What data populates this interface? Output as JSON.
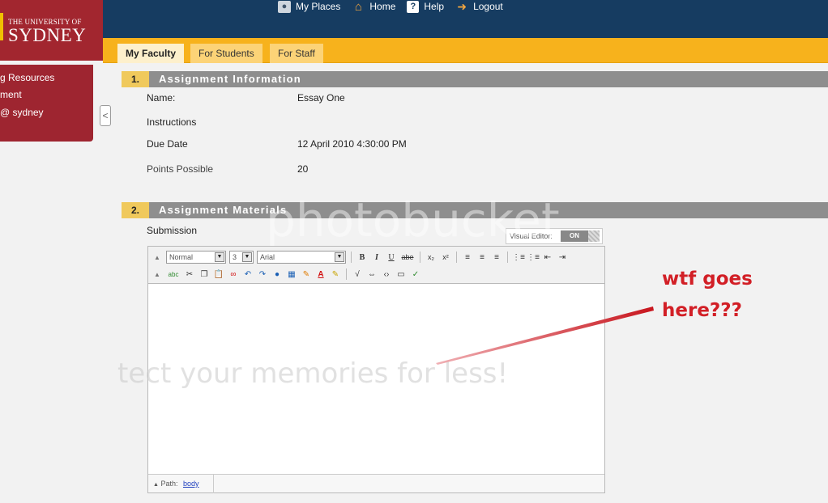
{
  "header": {
    "logo_line1": "THE UNIVERSITY OF",
    "logo_line2": "SYDNEY",
    "nav": [
      {
        "label": "My Places",
        "icon": "user-icon"
      },
      {
        "label": "Home",
        "icon": "home-icon"
      },
      {
        "label": "Help",
        "icon": "help-icon"
      },
      {
        "label": "Logout",
        "icon": "logout-icon"
      }
    ]
  },
  "tabs": [
    {
      "label": "My Faculty",
      "active": true
    },
    {
      "label": "For Students",
      "active": false
    },
    {
      "label": "For Staff",
      "active": false
    }
  ],
  "sidebar": {
    "items": [
      "g Resources",
      "ment",
      "@ sydney"
    ],
    "collapse_glyph": "<"
  },
  "section1": {
    "number": "1.",
    "title": "Assignment Information",
    "rows": {
      "name_label": "Name:",
      "name_value": "Essay One",
      "instructions_label": "Instructions",
      "due_label": "Due Date",
      "due_value": "12 April 2010 4:30:00 PM",
      "points_label": "Points Possible",
      "points_value": "20"
    }
  },
  "section2": {
    "number": "2.",
    "title": "Assignment Materials",
    "submission_label": "Submission"
  },
  "editor": {
    "visual_editor_label": "Visual Editor:",
    "visual_editor_state": "ON",
    "style_select": "Normal",
    "size_select": "3",
    "font_select": "Arial",
    "bold_glyph": "B",
    "italic_glyph": "I",
    "underline_glyph": "U",
    "strike_glyph": "abe",
    "spell_glyph": "abc",
    "path_label": "Path:",
    "path_value": "body"
  },
  "annotation": {
    "line1": "wtf goes",
    "line2": "here???"
  },
  "watermark": {
    "brand": "photobucket",
    "tagline": "tect your memories for less!"
  },
  "colors": {
    "header_navy": "#163c61",
    "logo_red": "#a2262f",
    "tab_orange": "#f7b21c",
    "section_gray": "#8e8e8e",
    "section_number_yellow": "#f0c95c",
    "annotation_red": "#d21f26"
  }
}
